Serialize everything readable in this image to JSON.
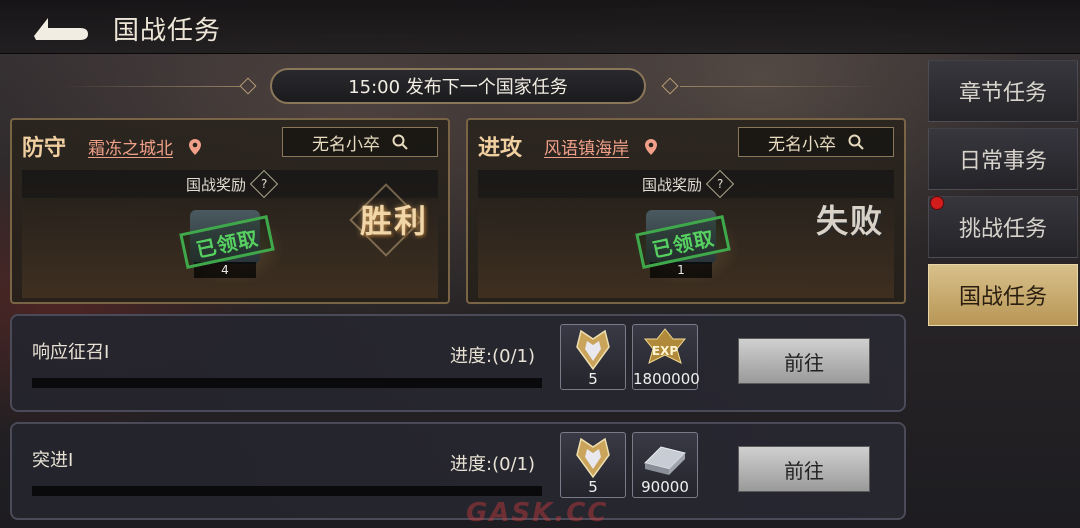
{
  "header": {
    "title": "国战任务"
  },
  "banner": {
    "text": "15:00 发布下一个国家任务"
  },
  "side_tabs": [
    {
      "label": "章节任务",
      "active": false,
      "red_dot": false
    },
    {
      "label": "日常事务",
      "active": false,
      "red_dot": false
    },
    {
      "label": "挑战任务",
      "active": false,
      "red_dot": true
    },
    {
      "label": "国战任务",
      "active": true,
      "red_dot": false
    }
  ],
  "cards": [
    {
      "type": "防守",
      "location": "霜冻之城北",
      "player": "无名小卒",
      "reward_title": "国战奖励",
      "help": "?",
      "reward_count": "4",
      "stamp": "已领取",
      "result": "胜利"
    },
    {
      "type": "进攻",
      "location": "风语镇海岸",
      "player": "无名小卒",
      "reward_title": "国战奖励",
      "help": "?",
      "reward_count": "1",
      "stamp": "已领取",
      "result": "失败"
    }
  ],
  "tasks": [
    {
      "name": "响应征召I",
      "progress_label": "进度:(0/1)",
      "progress": 0,
      "rewards": [
        {
          "icon": "honor-badge-icon",
          "count": "5"
        },
        {
          "icon": "exp-icon",
          "count": "1800000",
          "badge": "EXP"
        }
      ],
      "button": "前往"
    },
    {
      "name": "突进I",
      "progress_label": "进度:(0/1)",
      "progress": 0,
      "rewards": [
        {
          "icon": "honor-badge-icon",
          "count": "5"
        },
        {
          "icon": "silver-ingot-icon",
          "count": "90000"
        }
      ],
      "button": "前往"
    }
  ],
  "watermark": "GASK.CC",
  "colors": {
    "accent_gold": "#d8c08a",
    "location_link": "#f0a088",
    "stamp_green": "#56d060",
    "red_dot": "#d21c1c"
  }
}
